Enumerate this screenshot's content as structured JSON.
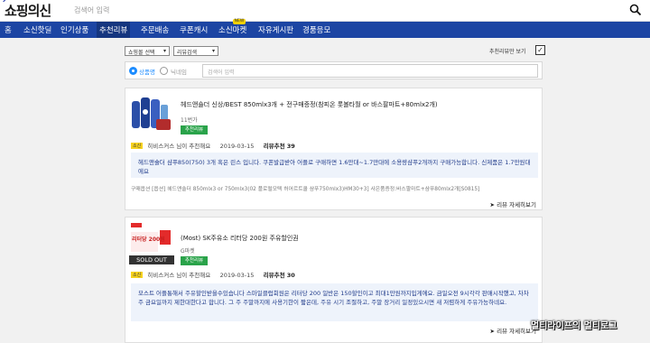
{
  "header": {
    "logo": "쇼핑의신",
    "search_placeholder": "검색어 입력"
  },
  "nav": {
    "items": [
      "홈",
      "소신핫딜",
      "인기상품",
      "추천리뷰",
      "주문배송",
      "쿠폰캐시",
      "소신마켓",
      "자유게시판",
      "경품응모"
    ],
    "active_index": 3,
    "new_badge": "NEW"
  },
  "filters": {
    "shop_select": "쇼핑몰 선택",
    "review_select": "리뷰검색",
    "recommended_only_label": "추천리뷰만 보기",
    "recommended_only_checked": true,
    "radio_product": "상품명",
    "radio_nickname": "닉네임",
    "search_placeholder": "검색어 입력"
  },
  "reviews": [
    {
      "title": "헤드앤숄더 신상/BEST 850mlx3개 + 전구매증정(참피온 롯볼타월 or 바스팔마트+80mlx2개)",
      "sub": "11번가",
      "badge": "추천리뷰",
      "tag": "소신",
      "user": "히비스커스",
      "user_suffix": "님이 추천해요",
      "date": "2019-03-15",
      "rec_label": "리뷰추천",
      "rec_count": "39",
      "body": "헤드앤숄더 샴푸850(750) 3개 혹은 린스 입니다. 쿠폰발급받아 어플로 구매하면 1.6만대~1.7만대에 소용량샴푸2개까지 구매가능합니다. 신제품은 1.7만원대에요",
      "option": "구매옵션 [옵션] 헤드앤숄더 850mlx3 or 750mlx3(02 플로럴모텍 허어르트쿨 샴푸750mlx3)HM30+3] 사은품증정:바스팔마트+샴푸80mlx2개[S0815]",
      "more": "리뷰 자세히보기"
    },
    {
      "title": "(Most) SK주유소 리터당 200원 주유할인권",
      "sub": "G마켓",
      "badge": "추천리뷰",
      "tag": "소신",
      "user": "히비스커스",
      "user_suffix": "님이 추천해요",
      "date": "2019-03-15",
      "rec_label": "리뷰추천",
      "rec_count": "30",
      "body": "모스트 어플통해서 주유할인받을수있습니다 스마일클럽회원은 리터당 200 일반은 150할인이고 최대1만원까지입게에요. 금일오전 9시각각 판매시작했고, 차차주 금요일까지 제한대한다고 합니다. 그 주 주말까지에 사용기한이 짧은데, 주유 시기 조절하고, 주말 장거리 일정있으시면 새 저렴하게 주유가능하네요.",
      "more": "리뷰 자세히보기",
      "thumb_text": "리터당 200원",
      "soldout": "SOLD OUT"
    }
  ],
  "watermark": "멀티라이프의 멀티로그"
}
